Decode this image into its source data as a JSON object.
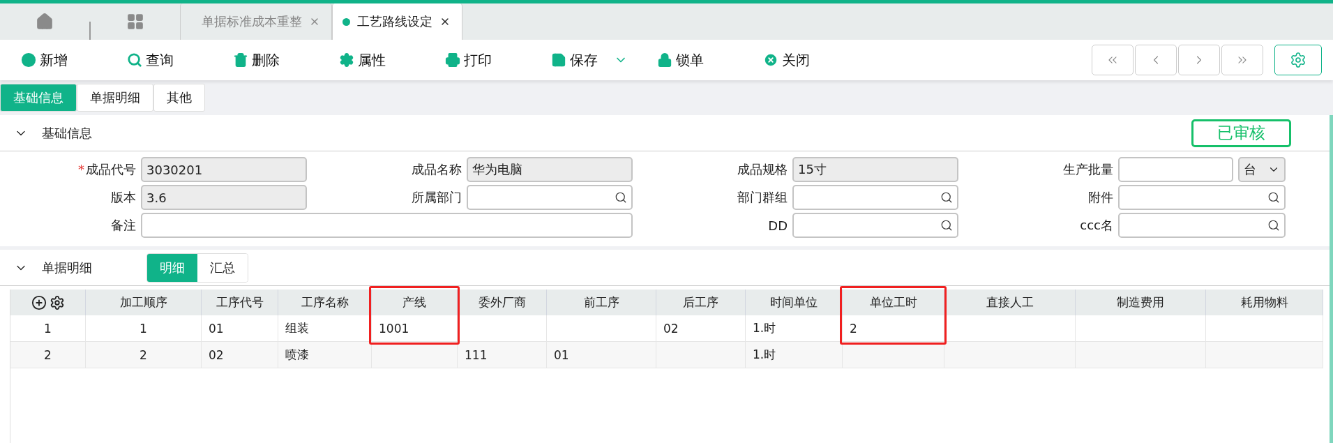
{
  "doc_tabs": [
    {
      "label": "单据标准成本重整",
      "selected": false
    },
    {
      "label": "工艺路线设定",
      "selected": true
    }
  ],
  "toolbar": [
    {
      "label": "新增",
      "kind": "add"
    },
    {
      "label": "查询",
      "kind": "search"
    },
    {
      "label": "删除",
      "kind": "delete"
    },
    {
      "label": "属性",
      "kind": "properties"
    },
    {
      "label": "打印",
      "kind": "print"
    },
    {
      "label": "保存",
      "kind": "save",
      "dropdown": true
    },
    {
      "label": "锁单",
      "kind": "lock"
    },
    {
      "label": "关闭",
      "kind": "close"
    }
  ],
  "page_tabs": [
    {
      "label": "基础信息",
      "selected": true
    },
    {
      "label": "单据明细",
      "selected": false
    },
    {
      "label": "其他",
      "selected": false
    }
  ],
  "basic_section": {
    "title": "基础信息",
    "expanded": true,
    "status": "已审核",
    "fields": [
      {
        "label": "成品代号",
        "value": "3030201",
        "kind": "readonly",
        "required_mark": "*"
      },
      {
        "label": "成品名称",
        "value": "华为电脑",
        "kind": "readonly"
      },
      {
        "label": "成品规格",
        "value": "15寸",
        "kind": "readonly"
      },
      {
        "label": "生产批量",
        "kind": "quantity",
        "unit": "台"
      },
      {
        "label": "版本",
        "value": "3.6",
        "kind": "readonly"
      },
      {
        "label": "所属部门",
        "kind": "lookup"
      },
      {
        "label": "部门群组",
        "kind": "lookup"
      },
      {
        "label": "附件",
        "kind": "lookup"
      },
      {
        "label": "备注",
        "kind": "wide"
      },
      {
        "label": "DD",
        "kind": "lookup"
      },
      {
        "label": "ccc名",
        "kind": "lookup"
      }
    ]
  },
  "detail_section": {
    "title": "单据明细",
    "expanded": true,
    "views": [
      {
        "label": "明细",
        "selected": true
      },
      {
        "label": "汇总",
        "selected": false
      }
    ],
    "table": {
      "columns": [
        {
          "label": "加工顺序",
          "highlight": false
        },
        {
          "label": "工序代号",
          "highlight": false
        },
        {
          "label": "工序名称",
          "highlight": false
        },
        {
          "label": "产线",
          "highlight": true
        },
        {
          "label": "委外厂商",
          "highlight": false
        },
        {
          "label": "前工序",
          "highlight": false
        },
        {
          "label": "后工序",
          "highlight": false
        },
        {
          "label": "时间单位",
          "highlight": false
        },
        {
          "label": "单位工时",
          "highlight": true
        },
        {
          "label": "直接人工",
          "highlight": false
        },
        {
          "label": "制造费用",
          "highlight": false
        },
        {
          "label": "耗用物料",
          "highlight": false
        }
      ],
      "rows": [
        {
          "number": "1",
          "cells": [
            "1",
            "01",
            "组装",
            "1001",
            "",
            "",
            "02",
            "1.时",
            "2",
            "",
            "",
            ""
          ]
        },
        {
          "number": "2",
          "cells": [
            "2",
            "02",
            "喷漆",
            "",
            "111",
            "01",
            "",
            "1.时",
            "",
            "",
            "",
            ""
          ]
        }
      ]
    }
  }
}
